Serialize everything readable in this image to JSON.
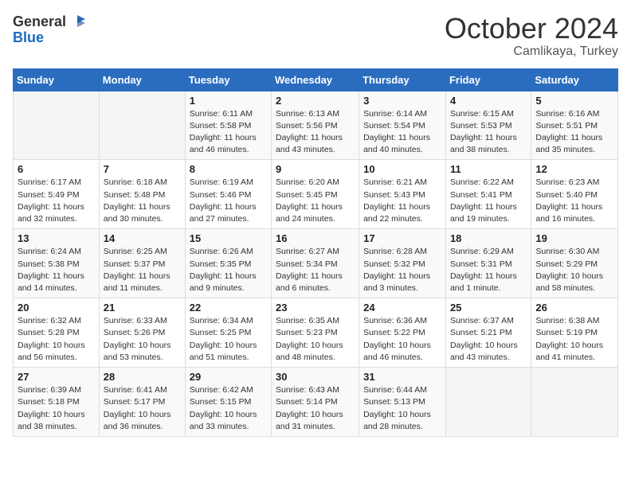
{
  "header": {
    "logo_general": "General",
    "logo_blue": "Blue",
    "month_title": "October 2024",
    "location": "Camlikaya, Turkey"
  },
  "weekdays": [
    "Sunday",
    "Monday",
    "Tuesday",
    "Wednesday",
    "Thursday",
    "Friday",
    "Saturday"
  ],
  "weeks": [
    [
      {
        "day": "",
        "info": ""
      },
      {
        "day": "",
        "info": ""
      },
      {
        "day": "1",
        "info": "Sunrise: 6:11 AM\nSunset: 5:58 PM\nDaylight: 11 hours and 46 minutes."
      },
      {
        "day": "2",
        "info": "Sunrise: 6:13 AM\nSunset: 5:56 PM\nDaylight: 11 hours and 43 minutes."
      },
      {
        "day": "3",
        "info": "Sunrise: 6:14 AM\nSunset: 5:54 PM\nDaylight: 11 hours and 40 minutes."
      },
      {
        "day": "4",
        "info": "Sunrise: 6:15 AM\nSunset: 5:53 PM\nDaylight: 11 hours and 38 minutes."
      },
      {
        "day": "5",
        "info": "Sunrise: 6:16 AM\nSunset: 5:51 PM\nDaylight: 11 hours and 35 minutes."
      }
    ],
    [
      {
        "day": "6",
        "info": "Sunrise: 6:17 AM\nSunset: 5:49 PM\nDaylight: 11 hours and 32 minutes."
      },
      {
        "day": "7",
        "info": "Sunrise: 6:18 AM\nSunset: 5:48 PM\nDaylight: 11 hours and 30 minutes."
      },
      {
        "day": "8",
        "info": "Sunrise: 6:19 AM\nSunset: 5:46 PM\nDaylight: 11 hours and 27 minutes."
      },
      {
        "day": "9",
        "info": "Sunrise: 6:20 AM\nSunset: 5:45 PM\nDaylight: 11 hours and 24 minutes."
      },
      {
        "day": "10",
        "info": "Sunrise: 6:21 AM\nSunset: 5:43 PM\nDaylight: 11 hours and 22 minutes."
      },
      {
        "day": "11",
        "info": "Sunrise: 6:22 AM\nSunset: 5:41 PM\nDaylight: 11 hours and 19 minutes."
      },
      {
        "day": "12",
        "info": "Sunrise: 6:23 AM\nSunset: 5:40 PM\nDaylight: 11 hours and 16 minutes."
      }
    ],
    [
      {
        "day": "13",
        "info": "Sunrise: 6:24 AM\nSunset: 5:38 PM\nDaylight: 11 hours and 14 minutes."
      },
      {
        "day": "14",
        "info": "Sunrise: 6:25 AM\nSunset: 5:37 PM\nDaylight: 11 hours and 11 minutes."
      },
      {
        "day": "15",
        "info": "Sunrise: 6:26 AM\nSunset: 5:35 PM\nDaylight: 11 hours and 9 minutes."
      },
      {
        "day": "16",
        "info": "Sunrise: 6:27 AM\nSunset: 5:34 PM\nDaylight: 11 hours and 6 minutes."
      },
      {
        "day": "17",
        "info": "Sunrise: 6:28 AM\nSunset: 5:32 PM\nDaylight: 11 hours and 3 minutes."
      },
      {
        "day": "18",
        "info": "Sunrise: 6:29 AM\nSunset: 5:31 PM\nDaylight: 11 hours and 1 minute."
      },
      {
        "day": "19",
        "info": "Sunrise: 6:30 AM\nSunset: 5:29 PM\nDaylight: 10 hours and 58 minutes."
      }
    ],
    [
      {
        "day": "20",
        "info": "Sunrise: 6:32 AM\nSunset: 5:28 PM\nDaylight: 10 hours and 56 minutes."
      },
      {
        "day": "21",
        "info": "Sunrise: 6:33 AM\nSunset: 5:26 PM\nDaylight: 10 hours and 53 minutes."
      },
      {
        "day": "22",
        "info": "Sunrise: 6:34 AM\nSunset: 5:25 PM\nDaylight: 10 hours and 51 minutes."
      },
      {
        "day": "23",
        "info": "Sunrise: 6:35 AM\nSunset: 5:23 PM\nDaylight: 10 hours and 48 minutes."
      },
      {
        "day": "24",
        "info": "Sunrise: 6:36 AM\nSunset: 5:22 PM\nDaylight: 10 hours and 46 minutes."
      },
      {
        "day": "25",
        "info": "Sunrise: 6:37 AM\nSunset: 5:21 PM\nDaylight: 10 hours and 43 minutes."
      },
      {
        "day": "26",
        "info": "Sunrise: 6:38 AM\nSunset: 5:19 PM\nDaylight: 10 hours and 41 minutes."
      }
    ],
    [
      {
        "day": "27",
        "info": "Sunrise: 6:39 AM\nSunset: 5:18 PM\nDaylight: 10 hours and 38 minutes."
      },
      {
        "day": "28",
        "info": "Sunrise: 6:41 AM\nSunset: 5:17 PM\nDaylight: 10 hours and 36 minutes."
      },
      {
        "day": "29",
        "info": "Sunrise: 6:42 AM\nSunset: 5:15 PM\nDaylight: 10 hours and 33 minutes."
      },
      {
        "day": "30",
        "info": "Sunrise: 6:43 AM\nSunset: 5:14 PM\nDaylight: 10 hours and 31 minutes."
      },
      {
        "day": "31",
        "info": "Sunrise: 6:44 AM\nSunset: 5:13 PM\nDaylight: 10 hours and 28 minutes."
      },
      {
        "day": "",
        "info": ""
      },
      {
        "day": "",
        "info": ""
      }
    ]
  ]
}
